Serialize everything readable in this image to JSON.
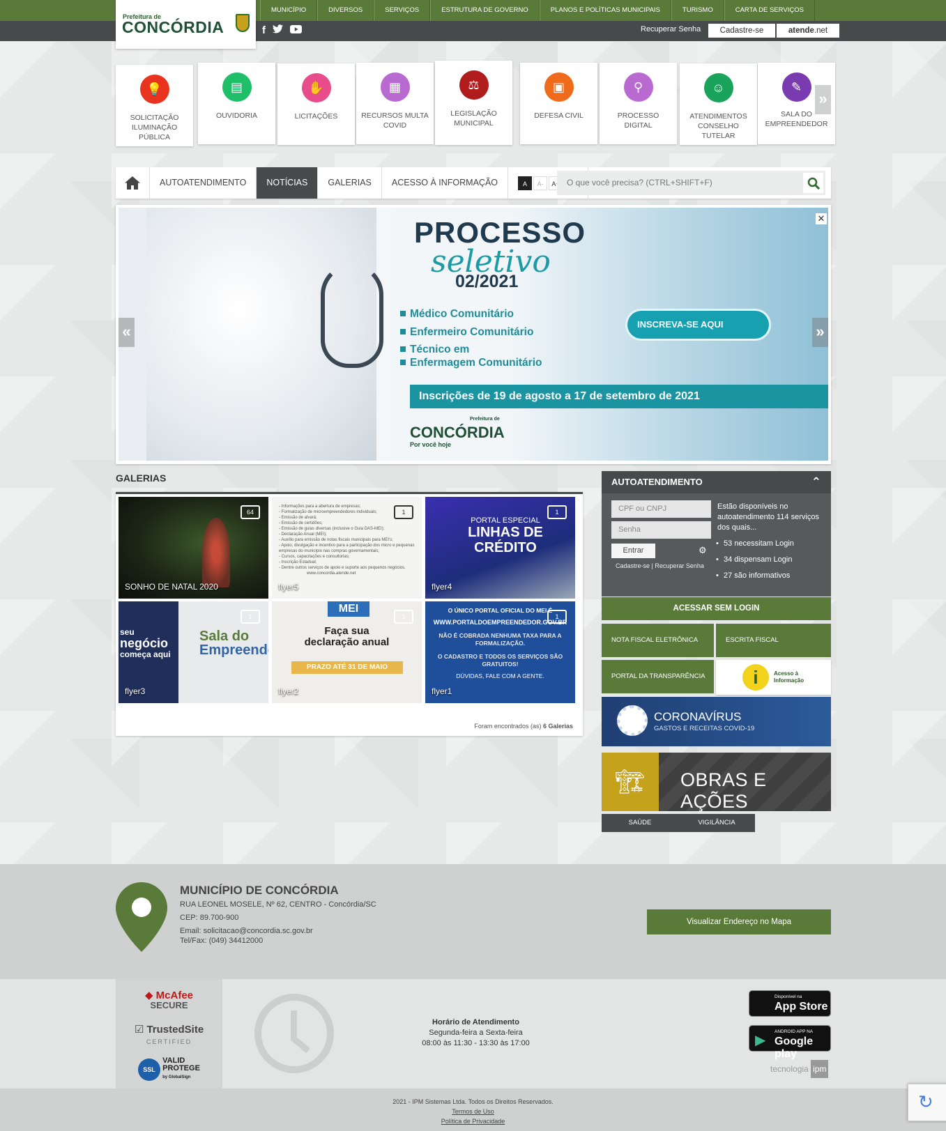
{
  "top_menu": [
    "MUNICÍPIO",
    "DIVERSOS",
    "SERVIÇOS",
    "ESTRUTURA DE GOVERNO",
    "PLANOS E POLÍTICAS MUNICIPAIS",
    "TURISMO",
    "CARTA DE SERVIÇOS"
  ],
  "logo": {
    "pre": "Prefeitura de",
    "main": "CONCÓRDIA"
  },
  "user_bar": {
    "recover": "Recuperar Senha",
    "register": "Cadastre-se",
    "atende_bold": "atende",
    "atende_rest": ".net"
  },
  "services": [
    {
      "label": "SOLICITAÇÃO ILUMINAÇÃO PÚBLICA",
      "color": "#e8331f",
      "icon": "lightbulb-icon"
    },
    {
      "label": "OUVIDORIA",
      "color": "#1fbf6a",
      "icon": "chat-bubbles-icon"
    },
    {
      "label": "LICITAÇÕES",
      "color": "#e84c8a",
      "icon": "handshake-icon"
    },
    {
      "label": "RECURSOS MULTA COVID",
      "color": "#b96ad1",
      "icon": "document-icon"
    },
    {
      "label": "LEGISLAÇÃO MUNICIPAL",
      "color": "#b01c1c",
      "icon": "scales-icon"
    },
    {
      "label": "DEFESA CIVIL",
      "color": "#ef6a1a",
      "icon": "shield-hands-icon"
    },
    {
      "label": "PROCESSO DIGITAL",
      "color": "#b96ad1",
      "icon": "magnifier-icon"
    },
    {
      "label": "ATENDIMENTOS CONSELHO TUTELAR",
      "color": "#1aa35a",
      "icon": "person-icon"
    },
    {
      "label": "SALA DO EMPREENDEDOR",
      "color": "#7b3bb0",
      "icon": "chart-icon"
    }
  ],
  "navbar": {
    "items": [
      "AUTOATENDIMENTO",
      "NOTÍCIAS",
      "GALERIAS",
      "ACESSO À INFORMAÇÃO"
    ],
    "active": "NOTÍCIAS",
    "font_controls": [
      "A",
      "A-",
      "A+",
      "✋"
    ],
    "search_placeholder": "O que você precisa? (CTRL+SHIFT+F)"
  },
  "banner": {
    "title": "PROCESSO",
    "script": "seletivo",
    "year": "02/2021",
    "items": [
      "Médico Comunitário",
      "Enfermeiro Comunitário",
      "Técnico em",
      "Enfermagem Comunitário"
    ],
    "cta": "INSCREVA-SE AQUI",
    "dates": "Inscrições de 19 de agosto a 17 de setembro de 2021",
    "logo_pre": "Prefeitura de",
    "logo": "CONCÓRDIA",
    "logo_sub": "Por você hoje"
  },
  "galerias": {
    "title": "GALERIAS",
    "tiles": [
      {
        "caption": "SONHO DE NATAL 2020",
        "count": "64"
      },
      {
        "caption": "flyer5",
        "count": "1"
      },
      {
        "caption": "flyer4",
        "count": "1"
      },
      {
        "caption": "flyer3",
        "count": "1"
      },
      {
        "caption": "flyer2",
        "count": "1"
      },
      {
        "caption": "flyer1",
        "count": "1"
      }
    ],
    "flyer4_text": [
      "PORTAL ESPECIAL",
      "LINHAS DE",
      "CRÉDITO"
    ],
    "flyer3_text": [
      "seu",
      "negócio",
      "começa aqui",
      "Sala do",
      "Empreendedor"
    ],
    "flyer2_text": [
      "MEI",
      "Faça sua",
      "declaração anual",
      "PRAZO ATÉ 31 DE MAIO"
    ],
    "flyer1_text": [
      "O ÚNICO PORTAL OFICIAL DO MEI É",
      "WWW.PORTALDOEMPREENDEDOR.GOV.BR",
      "NÃO É COBRADA NENHUMA TAXA PARA A FORMALIZAÇÃO.",
      "O CADASTRO E TODOS OS SERVIÇOS SÃO GRATUITOS!",
      "DÚVIDAS, FALE COM A GENTE."
    ],
    "flyer5_text": [
      "- Informações para a abertura de empresas;",
      "- Formalização de microempreendedores individuais;",
      "- Emissão de alvará;",
      "- Emissão de certidões;",
      "- Emissão de guias diversas (inclusive o Guia DAS-MEI);",
      "- Declaração Anual (MEI);",
      "- Auxílio para emissão de notas fiscais municipais para MEI's;",
      "- Apoio, divulgação e incentivo para a participação dos micro e pequenas empresas do município nas compras governamentais;",
      "- Cursos, capacitações e consultorias;",
      "- Inscrição Estadual;",
      "- Dentre outros serviços de apoio e suporte aos pequenos negócios.",
      "www.concordia.atende.net"
    ],
    "footer_pre": "Foram encontrados (as)",
    "footer_count": "6 Galerias"
  },
  "autoatendimento": {
    "title": "AUTOATENDIMENTO",
    "cpf_placeholder": "CPF ou CNPJ",
    "senha_placeholder": "Senha",
    "enter": "Entrar",
    "link_register": "Cadastre-se",
    "link_recover": "Recuperar Senha",
    "description": "Estão disponíveis no autoatendimento 114 serviços dos quais...",
    "stats": [
      "53 necessitam Login",
      "34 dispensam Login",
      "27 são informativos"
    ],
    "no_login": "ACESSAR SEM LOGIN",
    "buttons": [
      "NOTA FISCAL ELETRÔNICA",
      "ESCRITA FISCAL",
      "PORTAL DA TRANSPARÊNCIA"
    ],
    "acesso_info": [
      "Acesso à",
      "Informação"
    ]
  },
  "covid": {
    "title": "CORONAVÍRUS",
    "subtitle": "GASTOS E RECEITAS COVID-19"
  },
  "obras": "OBRAS E AÇÕES",
  "bottom_tabs": [
    "SAÚDE",
    "VIGILÂNCIA"
  ],
  "footer": {
    "title": "MUNICÍPIO DE CONCÓRDIA",
    "address": "RUA LEONEL MOSELE, Nº 62, CENTRO - Concórdia/SC",
    "cep": "CEP: 89.700-900",
    "email": "Email: solicitacao@concordia.sc.gov.br",
    "tel": "Tel/Fax: (049) 34412000",
    "map_button": "Visualizar Endereço no Mapa",
    "hours_title": "Horário de Atendimento",
    "hours_days": "Segunda-feira a Sexta-feira",
    "hours_time": "08:00 às 11:30 - 13:30 às 17:00",
    "seals": [
      "McAfee",
      "SECURE",
      "TrustedSite",
      "CERTIFIED",
      "VALID",
      "PROTEGE",
      "by GlobalSign"
    ],
    "app_store": {
      "small": "Disponível na",
      "big": "App Store"
    },
    "google_play": {
      "small": "ANDROID APP NA",
      "big": "Google play"
    },
    "tecno": "tecnologia",
    "tecno_brand": "ipm",
    "copyright": "2021 - IPM Sistemas Ltda. Todos os Direitos Reservados.",
    "terms": "Termos de Uso",
    "privacy": "Política de Privacidade"
  }
}
